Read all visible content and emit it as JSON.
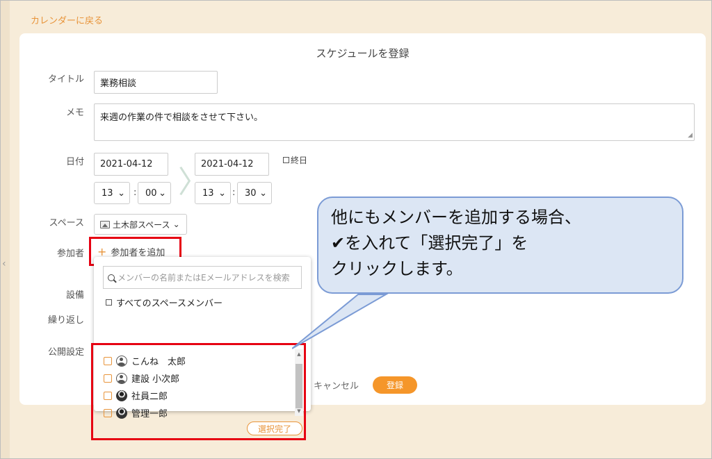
{
  "back_link": "カレンダーに戻る",
  "page_title": "スケジュールを登録",
  "fields": {
    "title_label": "タイトル",
    "title_value": "業務相談",
    "memo_label": "メモ",
    "memo_value": "来週の作業の件で相談をさせて下さい。",
    "date_label": "日付",
    "start_date": "2021-04-12",
    "start_hour": "13",
    "start_minute": "00",
    "end_date": "2021-04-12",
    "end_hour": "13",
    "end_minute": "30",
    "allday_label": "終日",
    "space_label": "スペース",
    "space_value": "土木部スペース",
    "participants_label": "参加者",
    "add_participant_label": "参加者を追加",
    "equipment_label": "設備",
    "repeat_label": "繰り返し",
    "visibility_label": "公開設定"
  },
  "dropdown": {
    "search_placeholder": "メンバーの名前またはEメールアドレスを検索",
    "all_members_label": "すべてのスペースメンバー",
    "members": [
      {
        "name": "こんね　太郎",
        "avatar": "default-avatar-icon"
      },
      {
        "name": "建設 小次郎",
        "avatar": "default-avatar-icon"
      },
      {
        "name": "社員二郎",
        "avatar": "photo-avatar"
      },
      {
        "name": "管理一郎",
        "avatar": "photo-avatar"
      }
    ],
    "done_label": "選択完了"
  },
  "actions": {
    "cancel_label": "キャンセル",
    "register_label": "登録"
  },
  "callout": {
    "line1": "他にもメンバーを追加する場合、",
    "line2": "✔を入れて「選択完了」を",
    "line3": "クリックします。"
  },
  "colors": {
    "accent": "#f5962a",
    "highlight": "#e60012",
    "callout_bg": "#dce6f4"
  }
}
